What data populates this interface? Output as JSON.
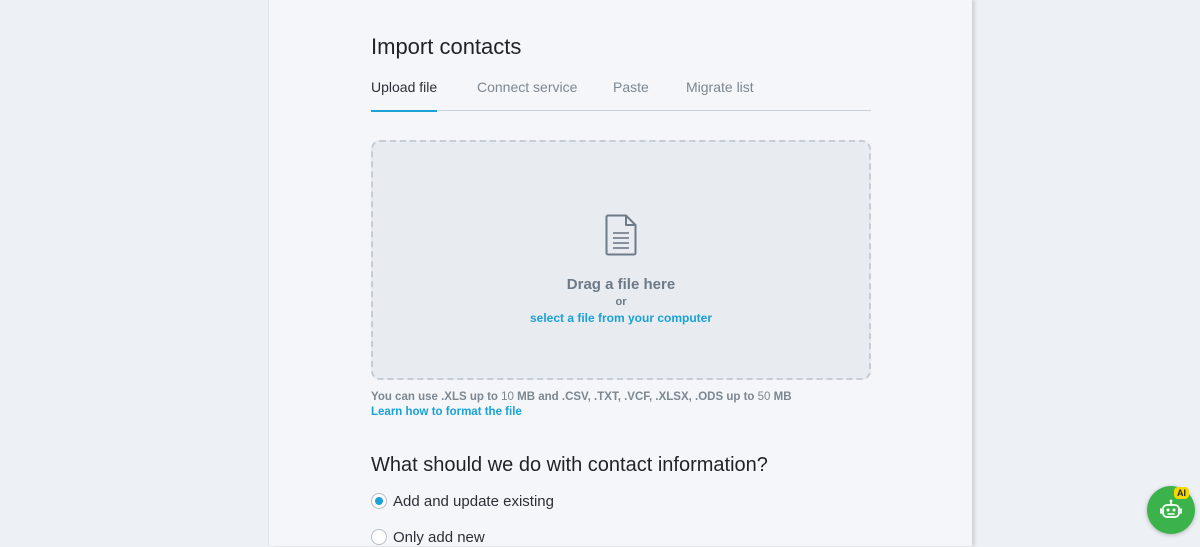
{
  "page": {
    "title": "Import contacts"
  },
  "tabs": [
    {
      "label": "Upload file",
      "active": true
    },
    {
      "label": "Connect service",
      "active": false
    },
    {
      "label": "Paste",
      "active": false
    },
    {
      "label": "Migrate list",
      "active": false
    }
  ],
  "dropzone": {
    "icon": "document-icon",
    "drag_text": "Drag a file here",
    "or_text": "or",
    "select_link": "select a file from your computer"
  },
  "limits": {
    "prefix": "You can use .XLS up to",
    "xls_size": "10",
    "mid": "MB and .CSV, .TXT, .VCF, .XLSX, .ODS up to",
    "other_size": "50",
    "suffix": "MB"
  },
  "learn_link": "Learn how to format the file",
  "contact_info": {
    "question": "What should we do with contact information?",
    "options": [
      {
        "label": "Add and update existing",
        "selected": true
      },
      {
        "label": "Only add new",
        "selected": false
      }
    ]
  },
  "assistant": {
    "icon": "robot-icon",
    "badge": "AI"
  },
  "colors": {
    "accent": "#1aa1d6",
    "assistant": "#3bb34a",
    "badge": "#f5d800"
  }
}
